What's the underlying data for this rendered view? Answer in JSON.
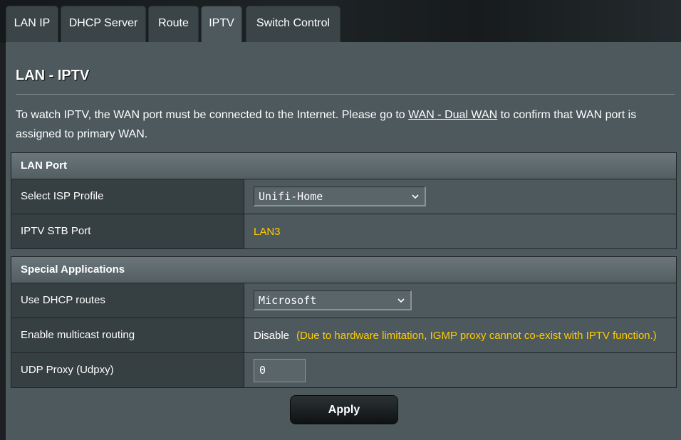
{
  "tabs": [
    {
      "label": "LAN IP",
      "active": false
    },
    {
      "label": "DHCP Server",
      "active": false
    },
    {
      "label": "Route",
      "active": false
    },
    {
      "label": "IPTV",
      "active": true
    },
    {
      "label": "Switch Control",
      "active": false
    }
  ],
  "page": {
    "title": "LAN - IPTV",
    "desc_before": "To watch IPTV, the WAN port must be connected to the Internet. Please go to ",
    "desc_link": "WAN - Dual WAN",
    "desc_after": " to confirm that WAN port is assigned to primary WAN."
  },
  "lan_port": {
    "heading": "LAN Port",
    "isp_profile_label": "Select ISP Profile",
    "isp_profile_value": "Unifi-Home",
    "stb_port_label": "IPTV STB Port",
    "stb_port_value": "LAN3"
  },
  "special_apps": {
    "heading": "Special Applications",
    "dhcp_routes_label": "Use DHCP routes",
    "dhcp_routes_value": "Microsoft",
    "multicast_label": "Enable multicast routing",
    "multicast_value": "Disable",
    "multicast_note": "(Due to hardware limitation, IGMP proxy cannot co-exist with IPTV function.)",
    "udpxy_label": "UDP Proxy (Udpxy)",
    "udpxy_value": "0"
  },
  "actions": {
    "apply_label": "Apply"
  },
  "colors": {
    "panel": "#4d595d",
    "label_cell": "#363f42",
    "highlight": "#ffcc00"
  }
}
